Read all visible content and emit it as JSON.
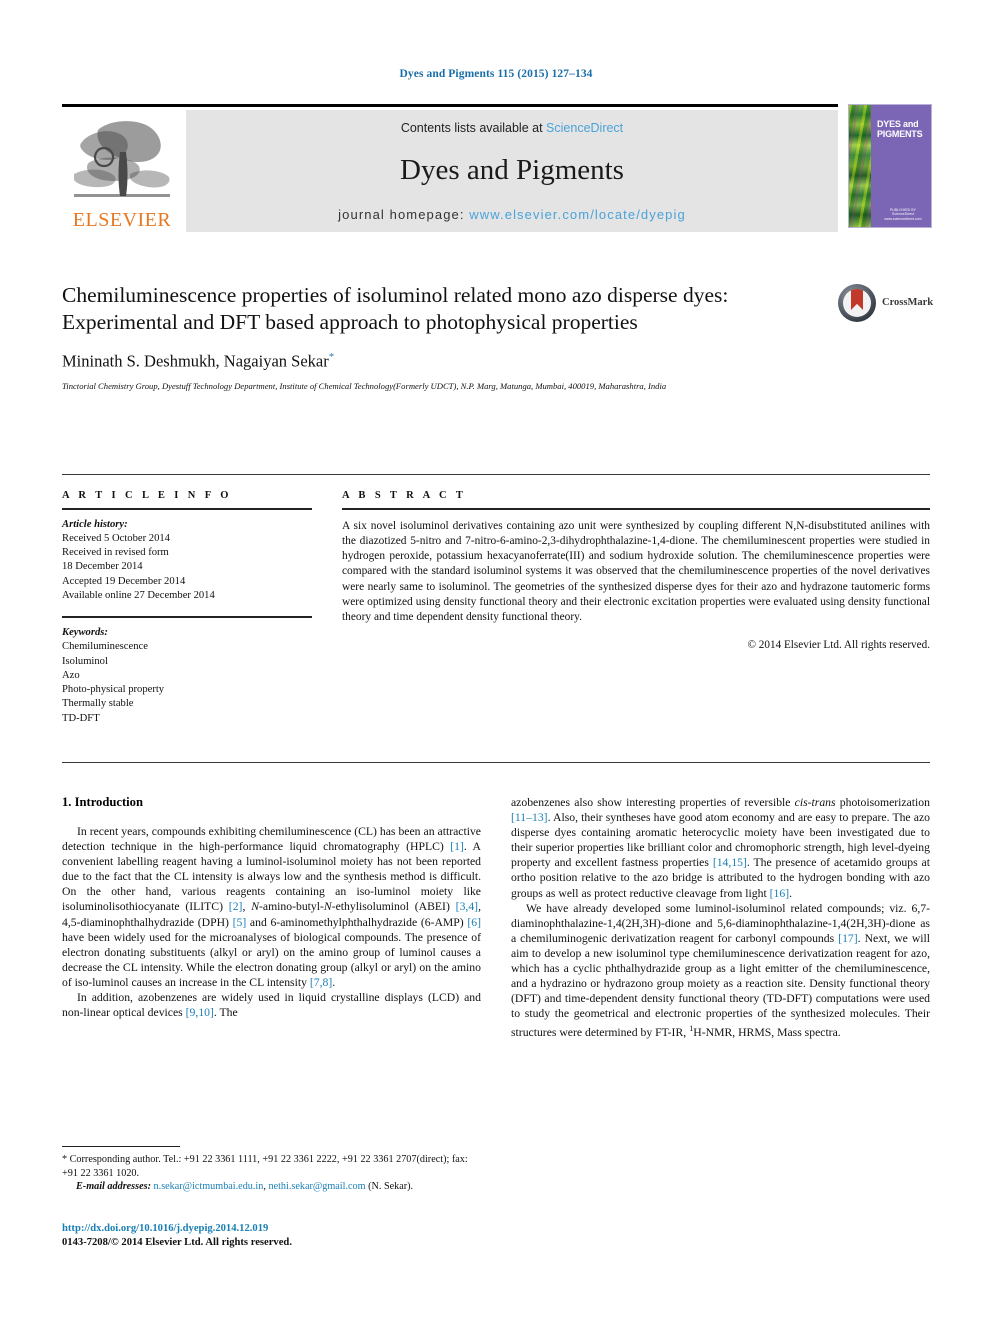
{
  "running_head": "Dyes and Pigments 115 (2015) 127–134",
  "masthead": {
    "contents_prefix": "Contents lists available at",
    "sciencedirect": "ScienceDirect",
    "journal_title": "Dyes and Pigments",
    "homepage_label": "journal homepage:",
    "homepage_url": "www.elsevier.com/locate/dyepig",
    "publisher_wordmark": "ELSEVIER",
    "cover_title": "DYES and PIGMENTS",
    "cover_footer": "PUBLISHED BY ScienceDirect www.sciencedirect.com"
  },
  "article": {
    "title": "Chemiluminescence properties of isoluminol related mono azo disperse dyes: Experimental and DFT based approach to photophysical properties",
    "authors": "Mininath S. Deshmukh, Nagaiyan Sekar",
    "corresponding_marker": "*",
    "affiliation": "Tinctorial Chemistry Group, Dyestuff Technology Department, Institute of Chemical Technology(Formerly UDCT), N.P. Marg, Matunga, Mumbai, 400019, Maharashtra, India",
    "crossmark_label": "CrossMark"
  },
  "article_info": {
    "heading": "A R T I C L E  I N F O",
    "history_label": "Article history:",
    "history": [
      "Received 5 October 2014",
      "Received in revised form",
      "18 December 2014",
      "Accepted 19 December 2014",
      "Available online 27 December 2014"
    ],
    "keywords_label": "Keywords:",
    "keywords": [
      "Chemiluminescence",
      "Isoluminol",
      "Azo",
      "Photo-physical property",
      "Thermally stable",
      "TD-DFT"
    ]
  },
  "abstract": {
    "heading": "A B S T R A C T",
    "text": "A six novel isoluminol derivatives containing azo unit were synthesized by coupling different N,N-disubstituted anilines with the diazotized 5-nitro and 7-nitro-6-amino-2,3-dihydrophthalazine-1,4-dione. The chemiluminescent properties were studied in hydrogen peroxide, potassium hexacyanoferrate(III) and sodium hydroxide solution. The chemiluminescence properties were compared with the standard isoluminol systems it was observed that the chemiluminescence properties of the novel derivatives were nearly same to isoluminol. The geometries of the synthesized disperse dyes for their azo and hydrazone tautomeric forms were optimized using density functional theory and their electronic excitation properties were evaluated using density functional theory and time dependent density functional theory.",
    "copyright": "© 2014 Elsevier Ltd. All rights reserved."
  },
  "introduction": {
    "heading": "1. Introduction",
    "left_paragraphs": [
      "In recent years, compounds exhibiting chemiluminescence (CL) has been an attractive detection technique in the high-performance liquid chromatography (HPLC) [1]. A convenient labelling reagent having a luminol-isoluminol moiety has not been reported due to the fact that the CL intensity is always low and the synthesis method is difficult. On the other hand, various reagents containing an iso-luminol moiety like isoluminolisothiocyanate (ILITC) [2], N-amino-butyl-N-ethylisoluminol (ABEI) [3,4], 4,5-diaminophthalhydrazide (DPH) [5] and 6-aminomethylphthalhydrazide (6-AMP) [6] have been widely used for the microanalyses of biological compounds. The presence of electron donating substituents (alkyl or aryl) on the amino group of luminol causes a decrease the CL intensity. While the electron donating group (alkyl or aryl) on the amino of iso-luminol causes an increase in the CL intensity [7,8].",
      "In addition, azobenzenes are widely used in liquid crystalline displays (LCD) and non-linear optical devices [9,10]. The"
    ],
    "right_paragraphs": [
      "azobenzenes also show interesting properties of reversible cis-trans photoisomerization [11–13]. Also, their syntheses have good atom economy and are easy to prepare. The azo disperse dyes containing aromatic heterocyclic moiety have been investigated due to their superior properties like brilliant color and chromophoric strength, high level-dyeing property and excellent fastness properties [14,15]. The presence of acetamido groups at ortho position relative to the azo bridge is attributed to the hydrogen bonding with azo groups as well as protect reductive cleavage from light [16].",
      "We have already developed some luminol-isoluminol related compounds; viz. 6,7-diaminophthalazine-1,4(2H,3H)-dione and 5,6-diaminophthalazine-1,4(2H,3H)-dione as a chemiluminogenic derivatization reagent for carbonyl compounds [17]. Next, we will aim to develop a new isoluminol type chemiluminescence derivatization reagent for azo, which has a cyclic phthalhydrazide group as a light emitter of the chemiluminescence, and a hydrazino or hydrazono group moiety as a reaction site. Density functional theory (DFT) and time-dependent density functional theory (TD-DFT) computations were used to study the geometrical and electronic properties of the synthesized molecules. Their structures were determined by FT-IR, 1H-NMR, HRMS, Mass spectra."
    ]
  },
  "footnote": {
    "corresponding": "* Corresponding author. Tel.: +91 22 3361 1111, +91 22 3361 2222, +91 22 3361 2707(direct); fax: +91 22 3361 1020.",
    "email_label": "E-mail addresses:",
    "email_1": "n.sekar@ictmumbai.edu.in",
    "email_2": "nethi.sekar@gmail.com",
    "email_suffix": "(N. Sekar).",
    "doi": "http://dx.doi.org/10.1016/j.dyepig.2014.12.019",
    "issn_copyright": "0143-7208/© 2014 Elsevier Ltd. All rights reserved."
  },
  "colors": {
    "link": "#1a7fb5",
    "running_head": "#1a6ea8",
    "elsevier_orange": "#e87722",
    "sciencedirect": "#4aa3d8",
    "cover_purple": "#7a66b5",
    "crossmark_red": "#c0392b"
  }
}
